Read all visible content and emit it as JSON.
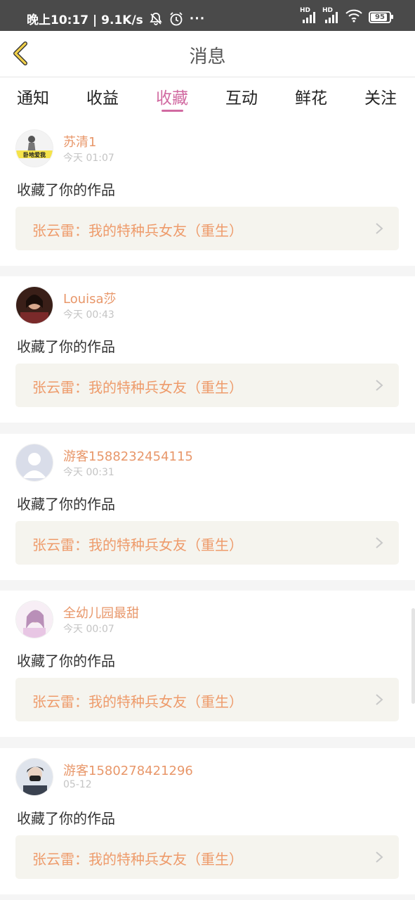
{
  "status_bar": {
    "time_speed": "晚上10:17 | 9.1K/s",
    "more": "···",
    "hd1": "HD",
    "hd2": "HD",
    "battery": "95",
    "icons": [
      "mute-bell-icon",
      "alarm-icon",
      "signal-icon",
      "signal-icon",
      "wifi-icon",
      "battery-icon"
    ]
  },
  "navbar": {
    "title": "消息",
    "back_icon": "back-chevron-icon"
  },
  "tabs": [
    {
      "label": "通知"
    },
    {
      "label": "收益"
    },
    {
      "label": "收藏",
      "active": true
    },
    {
      "label": "互动"
    },
    {
      "label": "鲜花"
    },
    {
      "label": "关注"
    }
  ],
  "items": [
    {
      "user": "苏清1",
      "time": "今天 01:07",
      "action": "收藏了你的作品",
      "work": "张云雷：我的特种兵女友（重生）",
      "avatar_caption": "卧地爱我"
    },
    {
      "user": "Louisa莎",
      "time": "今天 00:43",
      "action": "收藏了你的作品",
      "work": "张云雷：我的特种兵女友（重生）"
    },
    {
      "user": "游客1588232454115",
      "time": "今天 00:31",
      "action": "收藏了你的作品",
      "work": "张云雷：我的特种兵女友（重生）"
    },
    {
      "user": "全幼儿园最甜",
      "time": "今天 00:07",
      "action": "收藏了你的作品",
      "work": "张云雷：我的特种兵女友（重生）"
    },
    {
      "user": "游客1580278421296",
      "time": "05-12",
      "action": "收藏了你的作品",
      "work": "张云雷：我的特种兵女友（重生）"
    }
  ],
  "colors": {
    "accent_pink": "#d16aa1",
    "name_orange": "#e8976a",
    "work_orange": "#ee9b6b",
    "back_yellow": "#f2d14a"
  }
}
